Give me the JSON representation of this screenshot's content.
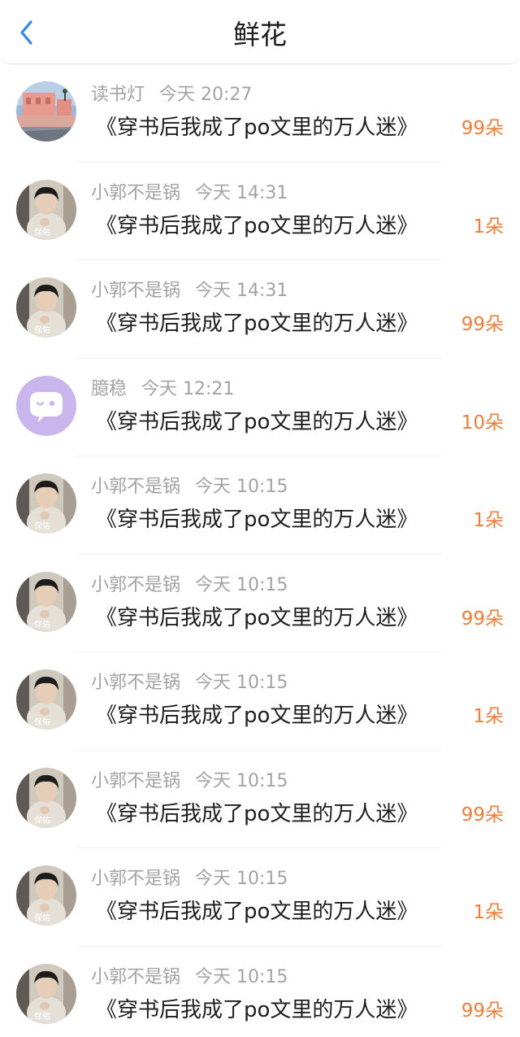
{
  "header": {
    "title": "鲜花",
    "back_icon": "chevron-left-icon",
    "accent": "#2f8be6"
  },
  "colors": {
    "count": "#ee7d3a",
    "meta": "#a3a3a3"
  },
  "items": [
    {
      "user": "读书灯",
      "time": "今天 20:27",
      "book": "《穿书后我成了po文里的万人迷》",
      "count": "99朵",
      "avatar": "landscape"
    },
    {
      "user": "小郭不是锅",
      "time": "今天 14:31",
      "book": "《穿书后我成了po文里的万人迷》",
      "count": "1朵",
      "avatar": "person"
    },
    {
      "user": "小郭不是锅",
      "time": "今天 14:31",
      "book": "《穿书后我成了po文里的万人迷》",
      "count": "99朵",
      "avatar": "person"
    },
    {
      "user": "臆稳",
      "time": "今天 12:21",
      "book": "《穿书后我成了po文里的万人迷》",
      "count": "10朵",
      "avatar": "chat-bubble"
    },
    {
      "user": "小郭不是锅",
      "time": "今天 10:15",
      "book": "《穿书后我成了po文里的万人迷》",
      "count": "1朵",
      "avatar": "person"
    },
    {
      "user": "小郭不是锅",
      "time": "今天 10:15",
      "book": "《穿书后我成了po文里的万人迷》",
      "count": "99朵",
      "avatar": "person"
    },
    {
      "user": "小郭不是锅",
      "time": "今天 10:15",
      "book": "《穿书后我成了po文里的万人迷》",
      "count": "1朵",
      "avatar": "person"
    },
    {
      "user": "小郭不是锅",
      "time": "今天 10:15",
      "book": "《穿书后我成了po文里的万人迷》",
      "count": "99朵",
      "avatar": "person"
    },
    {
      "user": "小郭不是锅",
      "time": "今天 10:15",
      "book": "《穿书后我成了po文里的万人迷》",
      "count": "1朵",
      "avatar": "person"
    },
    {
      "user": "小郭不是锅",
      "time": "今天 10:15",
      "book": "《穿书后我成了po文里的万人迷》",
      "count": "99朵",
      "avatar": "person"
    }
  ]
}
